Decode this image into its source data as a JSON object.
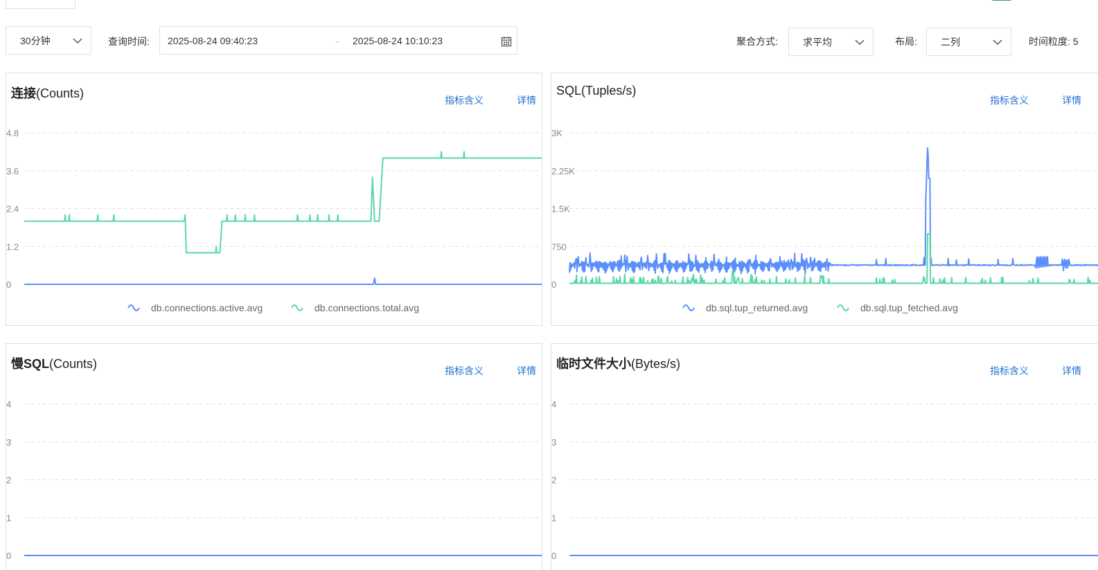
{
  "toolbar": {
    "range_select": "30分钟",
    "query_time_label": "查询时间:",
    "start_time": "2025-08-24 09:40:23",
    "range_sep": "-",
    "end_time": "2025-08-24 10:10:23",
    "agg_label": "聚合方式:",
    "agg_value": "求平均",
    "layout_label": "布局:",
    "layout_value": "二列",
    "granularity_label": "时间粒度: 5"
  },
  "links": {
    "meaning": "指标含义",
    "detail": "详情"
  },
  "colors": {
    "blue": "#5b8ff9",
    "green": "#5ad8a6",
    "grid": "#e0e0e0",
    "link": "#1f6fd1"
  },
  "panels": [
    {
      "title_main": "连接",
      "title_sub": "(Counts)",
      "chart_data": {
        "type": "line",
        "y_ticks": [
          "4.8",
          "3.6",
          "2.4",
          "1.2",
          "0"
        ],
        "ylim": [
          0,
          4.8
        ],
        "series": [
          {
            "name": "db.connections.active.avg",
            "color": "#5b8ff9",
            "points": [
              [
                0,
                0
              ],
              [
                0.675,
                0
              ],
              [
                0.677,
                0.2
              ],
              [
                0.679,
                0
              ],
              [
                1,
                0
              ]
            ]
          },
          {
            "name": "db.connections.total.avg",
            "color": "#5ad8a6",
            "points": [
              [
                0,
                2
              ],
              [
                0.078,
                2
              ],
              [
                0.079,
                2.2
              ],
              [
                0.08,
                2
              ],
              [
                0.086,
                2
              ],
              [
                0.087,
                2.2
              ],
              [
                0.088,
                2
              ],
              [
                0.141,
                2
              ],
              [
                0.142,
                2.2
              ],
              [
                0.143,
                2
              ],
              [
                0.172,
                2
              ],
              [
                0.173,
                2.2
              ],
              [
                0.174,
                2
              ],
              [
                0.309,
                2
              ],
              [
                0.311,
                2.2
              ],
              [
                0.313,
                1
              ],
              [
                0.345,
                1
              ],
              [
                0.35,
                1
              ],
              [
                0.37,
                1
              ],
              [
                0.371,
                1.2
              ],
              [
                0.372,
                1
              ],
              [
                0.378,
                1
              ],
              [
                0.382,
                2
              ],
              [
                0.391,
                2
              ],
              [
                0.392,
                2.2
              ],
              [
                0.393,
                2
              ],
              [
                0.407,
                2
              ],
              [
                0.408,
                2.2
              ],
              [
                0.409,
                2
              ],
              [
                0.426,
                2
              ],
              [
                0.427,
                2.2
              ],
              [
                0.428,
                2
              ],
              [
                0.444,
                2
              ],
              [
                0.445,
                2.2
              ],
              [
                0.446,
                2
              ],
              [
                0.527,
                2
              ],
              [
                0.528,
                2.2
              ],
              [
                0.53,
                2
              ],
              [
                0.551,
                2
              ],
              [
                0.552,
                2.2
              ],
              [
                0.553,
                2
              ],
              [
                0.566,
                2
              ],
              [
                0.567,
                2.2
              ],
              [
                0.568,
                2
              ],
              [
                0.588,
                2
              ],
              [
                0.589,
                2.2
              ],
              [
                0.59,
                2
              ],
              [
                0.605,
                2
              ],
              [
                0.606,
                2.2
              ],
              [
                0.607,
                2
              ],
              [
                0.67,
                2
              ],
              [
                0.673,
                3.4
              ],
              [
                0.677,
                2
              ],
              [
                0.686,
                2
              ],
              [
                0.693,
                4
              ],
              [
                0.805,
                4
              ],
              [
                0.806,
                4.2
              ],
              [
                0.807,
                4
              ],
              [
                0.849,
                4
              ],
              [
                0.85,
                4.2
              ],
              [
                0.851,
                4
              ],
              [
                1,
                4
              ]
            ]
          }
        ]
      }
    },
    {
      "title_main": "",
      "title_sub": "SQL(Tuples/s)",
      "chart_data": {
        "type": "line",
        "y_ticks": [
          "3K",
          "2.25K",
          "1.5K",
          "750",
          "0"
        ],
        "ylim": [
          0,
          3000
        ],
        "series": [
          {
            "name": "db.sql.tup_returned.avg",
            "color": "#5b8ff9",
            "pattern": "returned"
          },
          {
            "name": "db.sql.tup_fetched.avg",
            "color": "#5ad8a6",
            "pattern": "fetched"
          }
        ]
      }
    },
    {
      "title_main": "慢SQL",
      "title_sub": "(Counts)",
      "chart_data": {
        "type": "line",
        "y_ticks": [
          "4",
          "3",
          "2",
          "1",
          "0"
        ],
        "ylim": [
          0,
          4
        ],
        "series": [
          {
            "color": "#5b8ff9",
            "points": [
              [
                0,
                0
              ],
              [
                1,
                0
              ]
            ]
          }
        ]
      }
    },
    {
      "title_main": "临时文件大小",
      "title_sub": "(Bytes/s)",
      "chart_data": {
        "type": "line",
        "y_ticks": [
          "4",
          "3",
          "2",
          "1",
          "0"
        ],
        "ylim": [
          0,
          4
        ],
        "series": [
          {
            "color": "#5b8ff9",
            "points": [
              [
                0,
                0
              ],
              [
                1,
                0
              ]
            ]
          }
        ]
      }
    }
  ]
}
